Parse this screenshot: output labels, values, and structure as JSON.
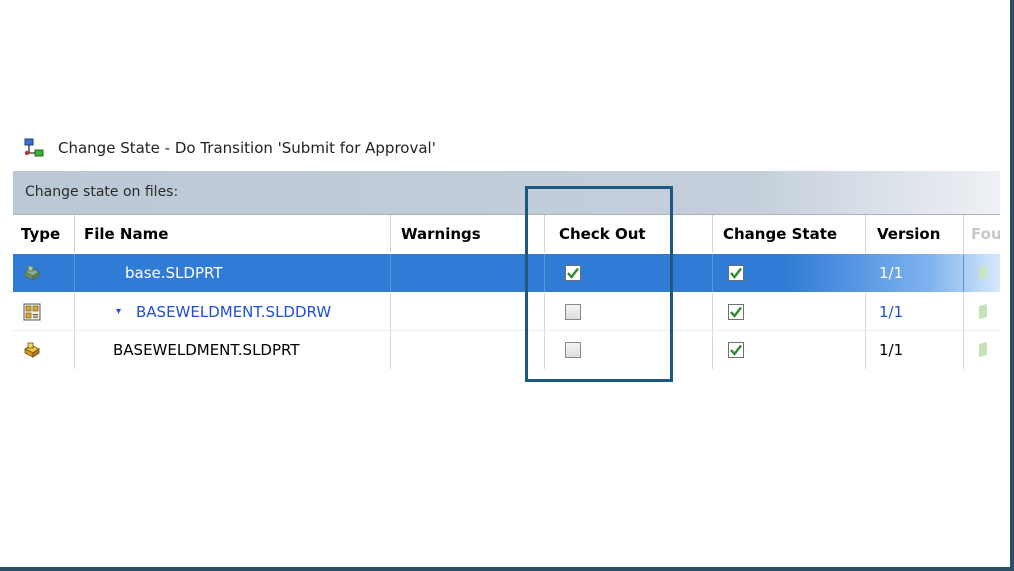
{
  "dialog": {
    "title": "Change State - Do Transition 'Submit for Approval'",
    "section_label": "Change state on files:"
  },
  "columns": {
    "type": "Type",
    "file_name": "File Name",
    "warnings": "Warnings",
    "check_out": "Check Out",
    "change_state": "Change State",
    "version": "Version",
    "found_in": "Fou"
  },
  "rows": [
    {
      "type_icon": "part-icon",
      "file_name": "base.SLDPRT",
      "warnings": "",
      "check_out": true,
      "change_state": true,
      "version": "1/1",
      "selected": true
    },
    {
      "type_icon": "drawing-icon",
      "tree_marker": "▾",
      "file_name": "BASEWELDMENT.SLDDRW",
      "warnings": "",
      "check_out": false,
      "change_state": true,
      "version": "1/1",
      "selected": false
    },
    {
      "type_icon": "part-icon",
      "file_name": "BASEWELDMENT.SLDPRT",
      "warnings": "",
      "check_out": false,
      "change_state": true,
      "version": "1/1",
      "selected": false
    }
  ],
  "colors": {
    "selection": "#2f7bd6",
    "link_text": "#1f4fd4",
    "highlight_border": "#1d5880",
    "check_green": "#2e8b2e"
  }
}
